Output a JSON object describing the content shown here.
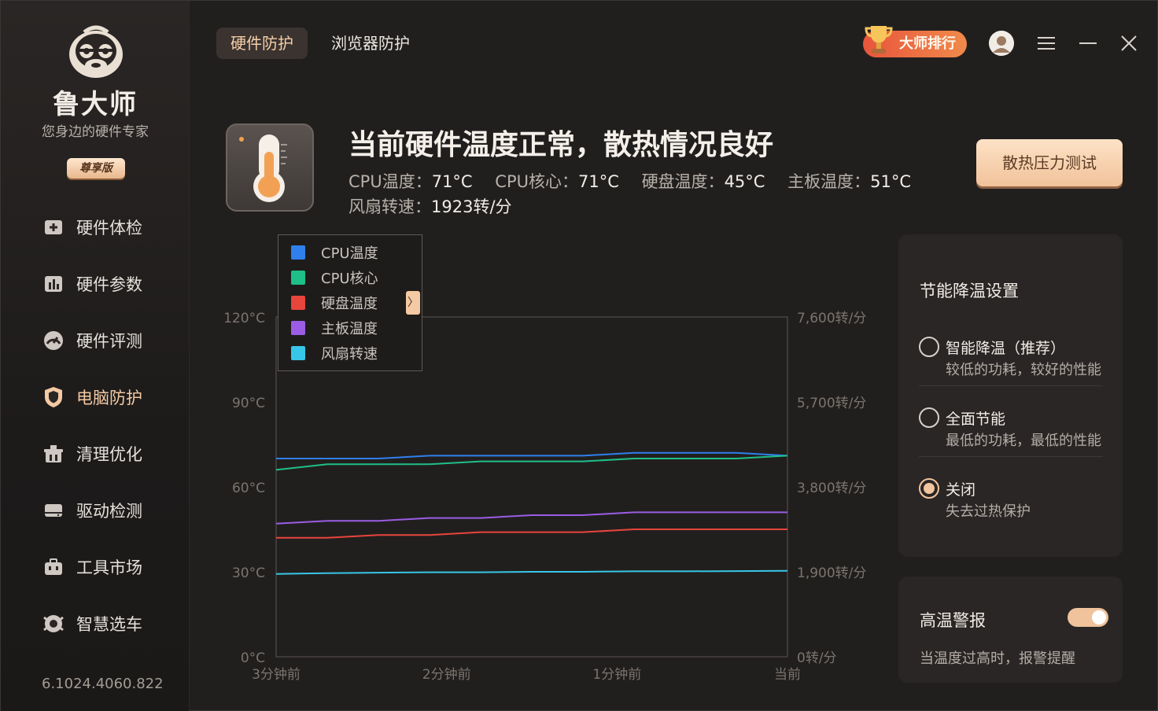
{
  "sidebar": {
    "brand_name": "鲁大师",
    "tagline": "您身边的硬件专家",
    "vip_label": "尊享版",
    "items": [
      {
        "label": "硬件体检",
        "icon": "health-check-icon"
      },
      {
        "label": "硬件参数",
        "icon": "bar-chart-icon"
      },
      {
        "label": "硬件评测",
        "icon": "speedometer-icon"
      },
      {
        "label": "电脑防护",
        "icon": "shield-icon"
      },
      {
        "label": "清理优化",
        "icon": "broom-icon"
      },
      {
        "label": "驱动检测",
        "icon": "drive-icon"
      },
      {
        "label": "工具市场",
        "icon": "toolbox-icon"
      },
      {
        "label": "智慧选车",
        "icon": "car-icon"
      }
    ],
    "active_index": 3,
    "version": "6.1024.4060.822"
  },
  "topbar": {
    "tabs": [
      {
        "label": "硬件防护",
        "active": true
      },
      {
        "label": "浏览器防护",
        "active": false
      }
    ],
    "rank_label": "大师排行"
  },
  "status": {
    "title": "当前硬件温度正常，散热情况良好",
    "cpu_temp_label": "CPU温度：",
    "cpu_temp_value": "71°C",
    "cpu_core_label": "CPU核心：",
    "cpu_core_value": "71°C",
    "disk_temp_label": "硬盘温度：",
    "disk_temp_value": "45°C",
    "board_temp_label": "主板温度：",
    "board_temp_value": "51°C",
    "fan_label": "风扇转速：",
    "fan_value": "1923转/分",
    "stress_test_label": "散热压力测试"
  },
  "chart_data": {
    "type": "line",
    "x_ticks": [
      "3分钟前",
      "2分钟前",
      "1分钟前",
      "当前"
    ],
    "y_left_ticks": [
      "0°C",
      "30°C",
      "60°C",
      "90°C",
      "120°C"
    ],
    "y_right_ticks": [
      "0转/分",
      "1,900转/分",
      "3,800转/分",
      "5,700转/分",
      "7,600转/分"
    ],
    "ylim_left": [
      0,
      120
    ],
    "ylim_right": [
      0,
      7600
    ],
    "legend_placement": "top-left",
    "series": [
      {
        "name": "CPU温度",
        "color": "#2f80ed",
        "axis": "left",
        "values": [
          70,
          70,
          70,
          71,
          71,
          71,
          71,
          72,
          72,
          72,
          71
        ]
      },
      {
        "name": "CPU核心",
        "color": "#1fbf8a",
        "axis": "left",
        "values": [
          66,
          68,
          68,
          68,
          69,
          69,
          69,
          70,
          70,
          70,
          71
        ]
      },
      {
        "name": "硬盘温度",
        "color": "#e8453c",
        "axis": "left",
        "values": [
          42,
          42,
          43,
          43,
          44,
          44,
          44,
          45,
          45,
          45,
          45
        ]
      },
      {
        "name": "主板温度",
        "color": "#9b5de5",
        "axis": "left",
        "values": [
          47,
          48,
          48,
          49,
          49,
          50,
          50,
          51,
          51,
          51,
          51
        ]
      },
      {
        "name": "风扇转速",
        "color": "#38c6e8",
        "axis": "right",
        "values": [
          1850,
          1870,
          1880,
          1890,
          1890,
          1900,
          1900,
          1910,
          1910,
          1915,
          1923
        ]
      }
    ]
  },
  "settings": {
    "title": "节能降温设置",
    "options": [
      {
        "title": "智能降温（推荐）",
        "desc": "较低的功耗，较好的性能",
        "selected": false
      },
      {
        "title": "全面节能",
        "desc": "最低的功耗，最低的性能",
        "selected": false
      },
      {
        "title": "关闭",
        "desc": "失去过热保护",
        "selected": true
      }
    ]
  },
  "alert": {
    "title": "高温警报",
    "desc": "当温度过高时，报警提醒",
    "enabled": true
  }
}
